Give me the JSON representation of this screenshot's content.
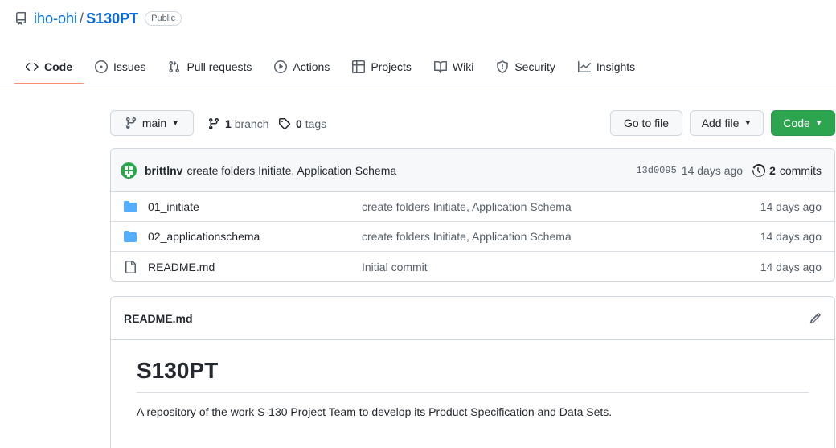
{
  "repo": {
    "owner": "iho-ohi",
    "separator": "/",
    "name": "S130PT",
    "visibility": "Public"
  },
  "tabs": [
    {
      "label": "Code",
      "icon": "code-icon",
      "active": true
    },
    {
      "label": "Issues",
      "icon": "issue-opened-icon"
    },
    {
      "label": "Pull requests",
      "icon": "git-pull-request-icon"
    },
    {
      "label": "Actions",
      "icon": "play-icon"
    },
    {
      "label": "Projects",
      "icon": "table-icon"
    },
    {
      "label": "Wiki",
      "icon": "book-icon"
    },
    {
      "label": "Security",
      "icon": "shield-icon"
    },
    {
      "label": "Insights",
      "icon": "graph-icon"
    }
  ],
  "branch_bar": {
    "branch_name": "main",
    "branch_count": "1",
    "branch_label": "branch",
    "tag_count": "0",
    "tag_label": "tags",
    "go_to_file": "Go to file",
    "add_file": "Add file",
    "code_button": "Code"
  },
  "latest_commit": {
    "author": "brittlnv",
    "message": "create folders Initiate, Application Schema",
    "sha": "13d0095",
    "age": "14 days ago",
    "commit_count": "2",
    "commit_label": "commits"
  },
  "files": [
    {
      "name": "01_initiate",
      "type": "folder",
      "commit": "create folders Initiate, Application Schema",
      "age": "14 days ago"
    },
    {
      "name": "02_applicationschema",
      "type": "folder",
      "commit": "create folders Initiate, Application Schema",
      "age": "14 days ago"
    },
    {
      "name": "README.md",
      "type": "file",
      "commit": "Initial commit",
      "age": "14 days ago"
    }
  ],
  "readme": {
    "filename": "README.md",
    "heading": "S130PT",
    "body": "A repository of the work S-130 Project Team to develop its Product Specification and Data Sets."
  },
  "colors": {
    "link": "#0969da",
    "accent_tab": "#fd8c73",
    "primary_button": "#2da44e",
    "folder": "#54aeff"
  }
}
